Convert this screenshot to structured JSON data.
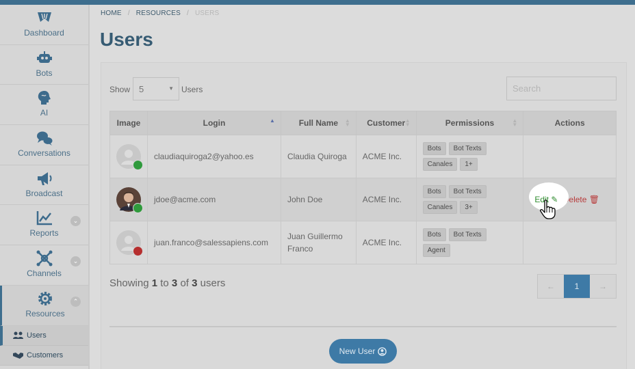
{
  "sidebar": {
    "items": [
      {
        "label": "Dashboard",
        "icon": "dashboard-icon"
      },
      {
        "label": "Bots",
        "icon": "robot-icon"
      },
      {
        "label": "AI",
        "icon": "brain-icon"
      },
      {
        "label": "Conversations",
        "icon": "chat-bubbles-icon"
      },
      {
        "label": "Broadcast",
        "icon": "megaphone-icon"
      },
      {
        "label": "Reports",
        "icon": "chart-line-icon"
      },
      {
        "label": "Channels",
        "icon": "network-icon"
      },
      {
        "label": "Resources",
        "icon": "gears-icon"
      }
    ],
    "sub_items": [
      {
        "label": "Users",
        "icon": "users-icon"
      },
      {
        "label": "Customers",
        "icon": "handshake-icon"
      }
    ]
  },
  "breadcrumb": {
    "home": "HOME",
    "resources": "RESOURCES",
    "current": "USERS"
  },
  "page": {
    "title": "Users"
  },
  "controls": {
    "show_label": "Show",
    "page_size": "5",
    "users_label": "Users",
    "search_placeholder": "Search"
  },
  "table": {
    "headers": [
      "Image",
      "Login",
      "Full Name",
      "Customer",
      "Permissions",
      "Actions"
    ],
    "rows": [
      {
        "login": "claudiaquiroga2@yahoo.es",
        "full_name": "Claudia Quiroga",
        "customer": "ACME Inc.",
        "tags": [
          "Bots",
          "Bot Texts",
          "Canales",
          "1+"
        ],
        "status_color": "#2f9a3c"
      },
      {
        "login": "jdoe@acme.com",
        "full_name": "John Doe",
        "customer": "ACME Inc.",
        "tags": [
          "Bots",
          "Bot Texts",
          "Canales",
          "3+"
        ],
        "status_color": "#2f9a3c"
      },
      {
        "login": "juan.franco@salessapiens.com",
        "full_name": "Juan Guillermo Franco",
        "customer": "ACME Inc.",
        "tags": [
          "Bots",
          "Bot Texts",
          "Agent"
        ],
        "status_color": "#b62f2f"
      }
    ],
    "actions": {
      "edit": "Edit",
      "delete": "Delete"
    }
  },
  "footer": {
    "showing_prefix": "Showing",
    "from": "1",
    "to_word": "to",
    "to": "3",
    "of_word": "of",
    "total": "3",
    "suffix": "users",
    "current_page": "1",
    "new_user": "New User"
  }
}
